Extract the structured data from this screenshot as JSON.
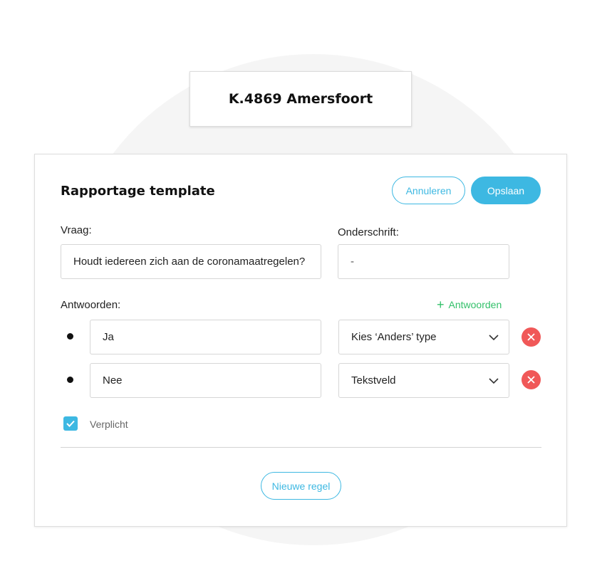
{
  "location": {
    "title": "K.4869 Amersfoort"
  },
  "panel": {
    "title": "Rapportage template",
    "cancel_label": "Annuleren",
    "save_label": "Opslaan"
  },
  "question": {
    "label": "Vraag:",
    "value": "Houdt iedereen zich aan de coronamaatregelen?"
  },
  "caption": {
    "label": "Onderschrift:",
    "value": "-"
  },
  "answers": {
    "label": "Antwoorden:",
    "add_label": "Antwoorden",
    "items": [
      {
        "value": "Ja",
        "type": "Kies ‘Anders’ type"
      },
      {
        "value": "Nee",
        "type": "Tekstveld"
      }
    ]
  },
  "required": {
    "label": "Verplicht",
    "checked": true
  },
  "new_row_label": "Nieuwe regel",
  "icons": {
    "plus": "plus-icon",
    "chevron": "chevron-down-icon",
    "remove": "close-icon",
    "check": "check-icon"
  },
  "colors": {
    "accent": "#3db8e2",
    "add": "#33c06a",
    "danger": "#f05858"
  }
}
